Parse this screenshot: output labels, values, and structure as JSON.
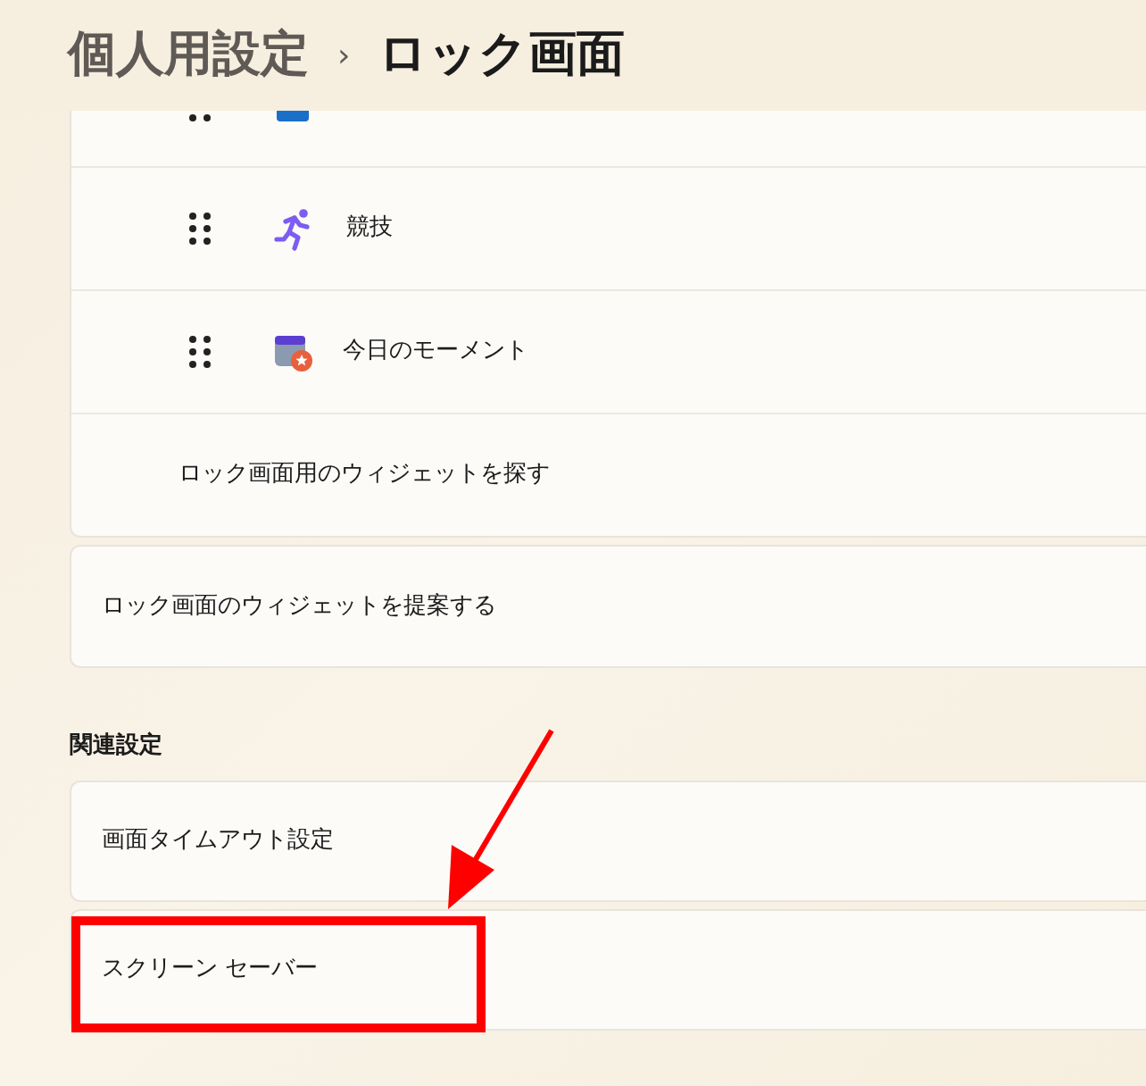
{
  "breadcrumb": {
    "parent": "個人用設定",
    "separator": "›",
    "current": "ロック画面"
  },
  "widgets": {
    "items": [
      {
        "kind": "cut"
      },
      {
        "kind": "widget",
        "label": "競技"
      },
      {
        "kind": "widget",
        "label": "今日のモーメント"
      },
      {
        "kind": "link",
        "label": "ロック画面用のウィジェットを探す"
      }
    ]
  },
  "suggest_card": {
    "label": "ロック画面のウィジェットを提案する"
  },
  "related": {
    "heading": "関連設定",
    "items": [
      {
        "label": "画面タイムアウト設定",
        "highlighted": false
      },
      {
        "label": "スクリーン セーバー",
        "highlighted": true
      }
    ]
  }
}
